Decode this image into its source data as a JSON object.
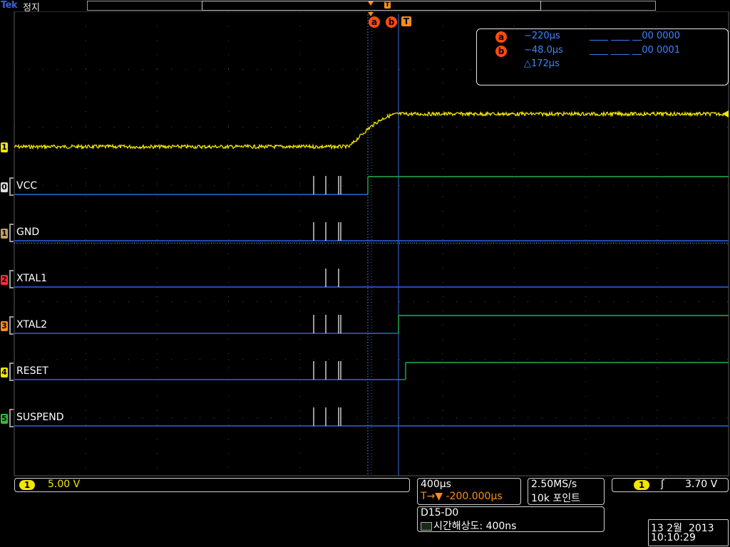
{
  "header": {
    "logo": "Tek",
    "run_state": "정지",
    "trigger_marker": "T"
  },
  "cursors": {
    "a_label": "a",
    "b_label": "b",
    "trigger_label": "T",
    "a_time": "−220µs",
    "b_time": "−48.0µs",
    "delta": "△172µs",
    "a_bits": "____ ____ __00 0000",
    "b_bits": "____ ____ __00 0001"
  },
  "channels": {
    "analog_label": "1",
    "digital": [
      {
        "num": "0",
        "name": "VCC",
        "color": "#e0e0e0"
      },
      {
        "num": "1",
        "name": "GND",
        "color": "#c8a060"
      },
      {
        "num": "2",
        "name": "XTAL1",
        "color": "#ff3030"
      },
      {
        "num": "3",
        "name": "XTAL2",
        "color": "#ff8c1a"
      },
      {
        "num": "4",
        "name": "RESET",
        "color": "#f1e600"
      },
      {
        "num": "5",
        "name": "SUSPEND",
        "color": "#30c030"
      }
    ]
  },
  "status": {
    "ch1_label": "1",
    "ch1_scale": "5.00 V",
    "timebase": "400µs",
    "trigger_pos": "T→▼ -200.000µs",
    "sample_rate": "2.50MS/s",
    "record_length": "10k 포인트",
    "trigger_ch": "1",
    "trigger_slope": "ʃ",
    "trigger_level": "3.70 V",
    "bus_range": "D15-D0",
    "timing_res": "시간해상도: 400ns",
    "date": "13 2월  2013",
    "time": "10:10:29"
  },
  "colors": {
    "analog_trace": "#f1e600",
    "digital_low": "#2a66e6",
    "digital_high": "#22b04a",
    "cursor_line": "#3a6fe0",
    "cursor_marker": "#ff4b10"
  }
}
